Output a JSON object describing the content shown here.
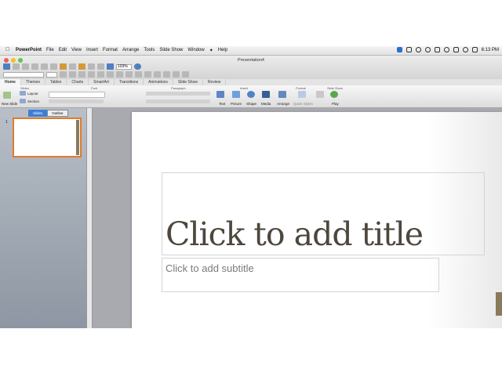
{
  "menubar": {
    "items": [
      "PowerPoint",
      "File",
      "Edit",
      "View",
      "Insert",
      "Format",
      "Arrange",
      "Tools",
      "Slide Show",
      "Window",
      "Help"
    ],
    "clock": "6:13 PM"
  },
  "window": {
    "title": "Presentation4",
    "zoom": "103%"
  },
  "ribbon": {
    "tabs": [
      "Home",
      "Themes",
      "Tables",
      "Charts",
      "SmartArt",
      "Transitions",
      "Animations",
      "Slide Show",
      "Review"
    ],
    "groups": [
      "Slides",
      "Font",
      "Paragraph",
      "Insert",
      "Format",
      "Slide Show"
    ],
    "buttons": {
      "new_slide": "New Slide",
      "layout": "Layout",
      "section": "Section",
      "text": "Text",
      "picture": "Picture",
      "shape": "Shape",
      "media": "Media",
      "arrange": "Arrange",
      "quick_styles": "Quick Styles",
      "play": "Play"
    }
  },
  "left_panel": {
    "tabs": [
      "Slides",
      "Outline"
    ],
    "active_tab": "Slides",
    "slide_number": "1"
  },
  "slide": {
    "title_placeholder": "Click to add title",
    "subtitle_placeholder": "Click to add subtitle"
  },
  "colors": {
    "accent": "#3c7fd6",
    "thumb_border": "#e07b2a",
    "title_text": "#4d473c"
  },
  "icons": [
    "apple-icon",
    "wifi-icon",
    "battery-icon",
    "search-icon",
    "new-slide-icon",
    "layout-icon",
    "play-icon"
  ]
}
